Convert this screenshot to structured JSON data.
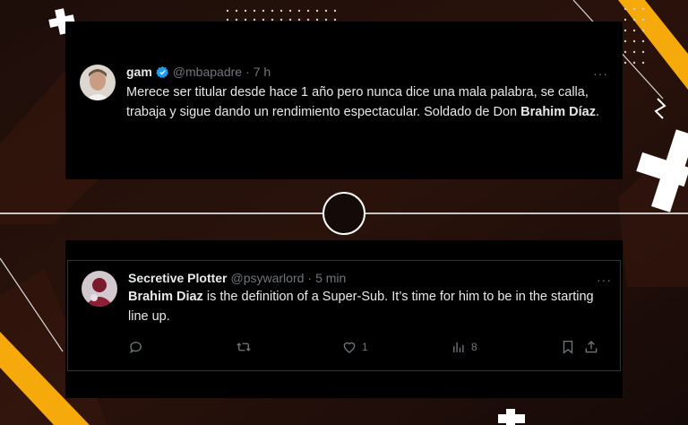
{
  "tweets": [
    {
      "name": "gam",
      "handle": "@mbapadre",
      "separator": "·",
      "time": "7 h",
      "text_prefix": "Merece ser titular desde hace 1 año pero nunca dice una mala palabra, se calla, trabaja y sigue dando un rendimiento espectacular. Soldado de Don ",
      "text_bold": "Brahim Díaz",
      "text_suffix": ".",
      "more": "···"
    },
    {
      "name": "Secretive Plotter",
      "handle": "@psywarlord",
      "separator": "·",
      "time": "5 min",
      "text_bold": "Brahim Diaz",
      "text_suffix": " is the definition of a Super-Sub. It’s time for him to be in the starting line up.",
      "more": "···",
      "actions": {
        "reply_count": "",
        "retweet_count": "",
        "like_count": "1",
        "views_count": "8"
      }
    }
  ],
  "icons": [
    "verified-badge-icon",
    "reply-icon",
    "retweet-icon",
    "like-icon",
    "views-icon",
    "bookmark-icon",
    "share-icon",
    "more-icon"
  ],
  "colors": {
    "accent_yellow": "#f5a90a",
    "verified_blue": "#1d9bf0",
    "background": "#140b09",
    "card": "#000000"
  }
}
